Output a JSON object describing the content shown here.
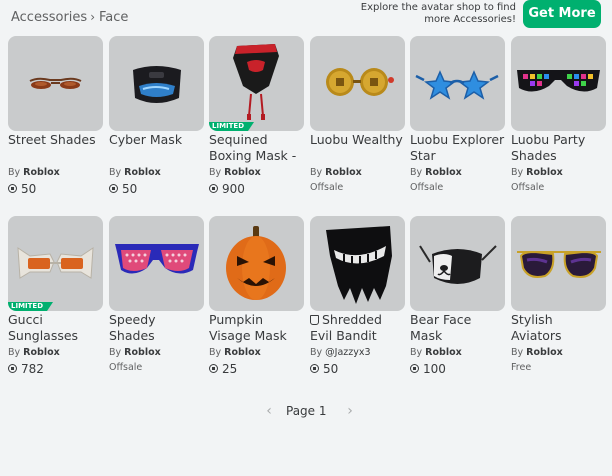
{
  "breadcrumb": {
    "parent": "Accessories",
    "separator": "›",
    "current": "Face"
  },
  "promo": {
    "text": "Explore the avatar shop to find more Accessories!",
    "button_label": "Get More"
  },
  "items": [
    {
      "name": "Street Shades",
      "creator_prefix": "By",
      "creator": "Roblox",
      "price": "50",
      "limited": false,
      "icon": "sunglasses-icon"
    },
    {
      "name": "Cyber Mask",
      "creator_prefix": "By",
      "creator": "Roblox",
      "price": "50",
      "limited": false,
      "icon": "cyber-mask-icon"
    },
    {
      "name": "Sequined Boxing Mask -",
      "creator_prefix": "By",
      "creator": "Roblox",
      "price": "900",
      "limited": true,
      "limited_label": "LIMITED",
      "icon": "boxing-mask-icon"
    },
    {
      "name": "Luobu Wealthy",
      "creator_prefix": "By",
      "creator": "Roblox",
      "status": "Offsale",
      "limited": false,
      "icon": "coin-glasses-icon"
    },
    {
      "name": "Luobu Explorer Star",
      "creator_prefix": "By",
      "creator": "Roblox",
      "status": "Offsale",
      "limited": false,
      "icon": "star-glasses-icon"
    },
    {
      "name": "Luobu Party Shades",
      "creator_prefix": "By",
      "creator": "Roblox",
      "status": "Offsale",
      "limited": false,
      "icon": "party-shades-icon"
    },
    {
      "name": "Gucci Sunglasses",
      "creator_prefix": "By",
      "creator": "Roblox",
      "price": "782",
      "limited": true,
      "limited_label": "LIMITED",
      "icon": "gucci-sunglasses-icon"
    },
    {
      "name": "Speedy Shades",
      "creator_prefix": "By",
      "creator": "Roblox",
      "status": "Offsale",
      "limited": false,
      "icon": "speedy-shades-icon"
    },
    {
      "name": "Pumpkin Visage Mask",
      "creator_prefix": "By",
      "creator": "Roblox",
      "price": "25",
      "limited": false,
      "icon": "pumpkin-mask-icon"
    },
    {
      "name": "Shredded Evil Bandit",
      "creator_prefix": "By",
      "creator": "@Jazzyx3",
      "price": "50",
      "limited": false,
      "verified_badge": true,
      "icon": "bandit-mask-icon"
    },
    {
      "name": "Bear Face Mask",
      "creator_prefix": "By",
      "creator": "Roblox",
      "price": "100",
      "limited": false,
      "icon": "bear-mask-icon"
    },
    {
      "name": "Stylish Aviators",
      "creator_prefix": "By",
      "creator": "Roblox",
      "status": "Free",
      "limited": false,
      "icon": "aviators-icon"
    }
  ],
  "pagination": {
    "label": "Page 1",
    "prev_icon": "chevron-left-icon",
    "next_icon": "chevron-right-icon"
  },
  "colors": {
    "accent": "#00b06f",
    "background": "#f2f4f5",
    "thumbnail_bg": "#c9cbcc"
  }
}
